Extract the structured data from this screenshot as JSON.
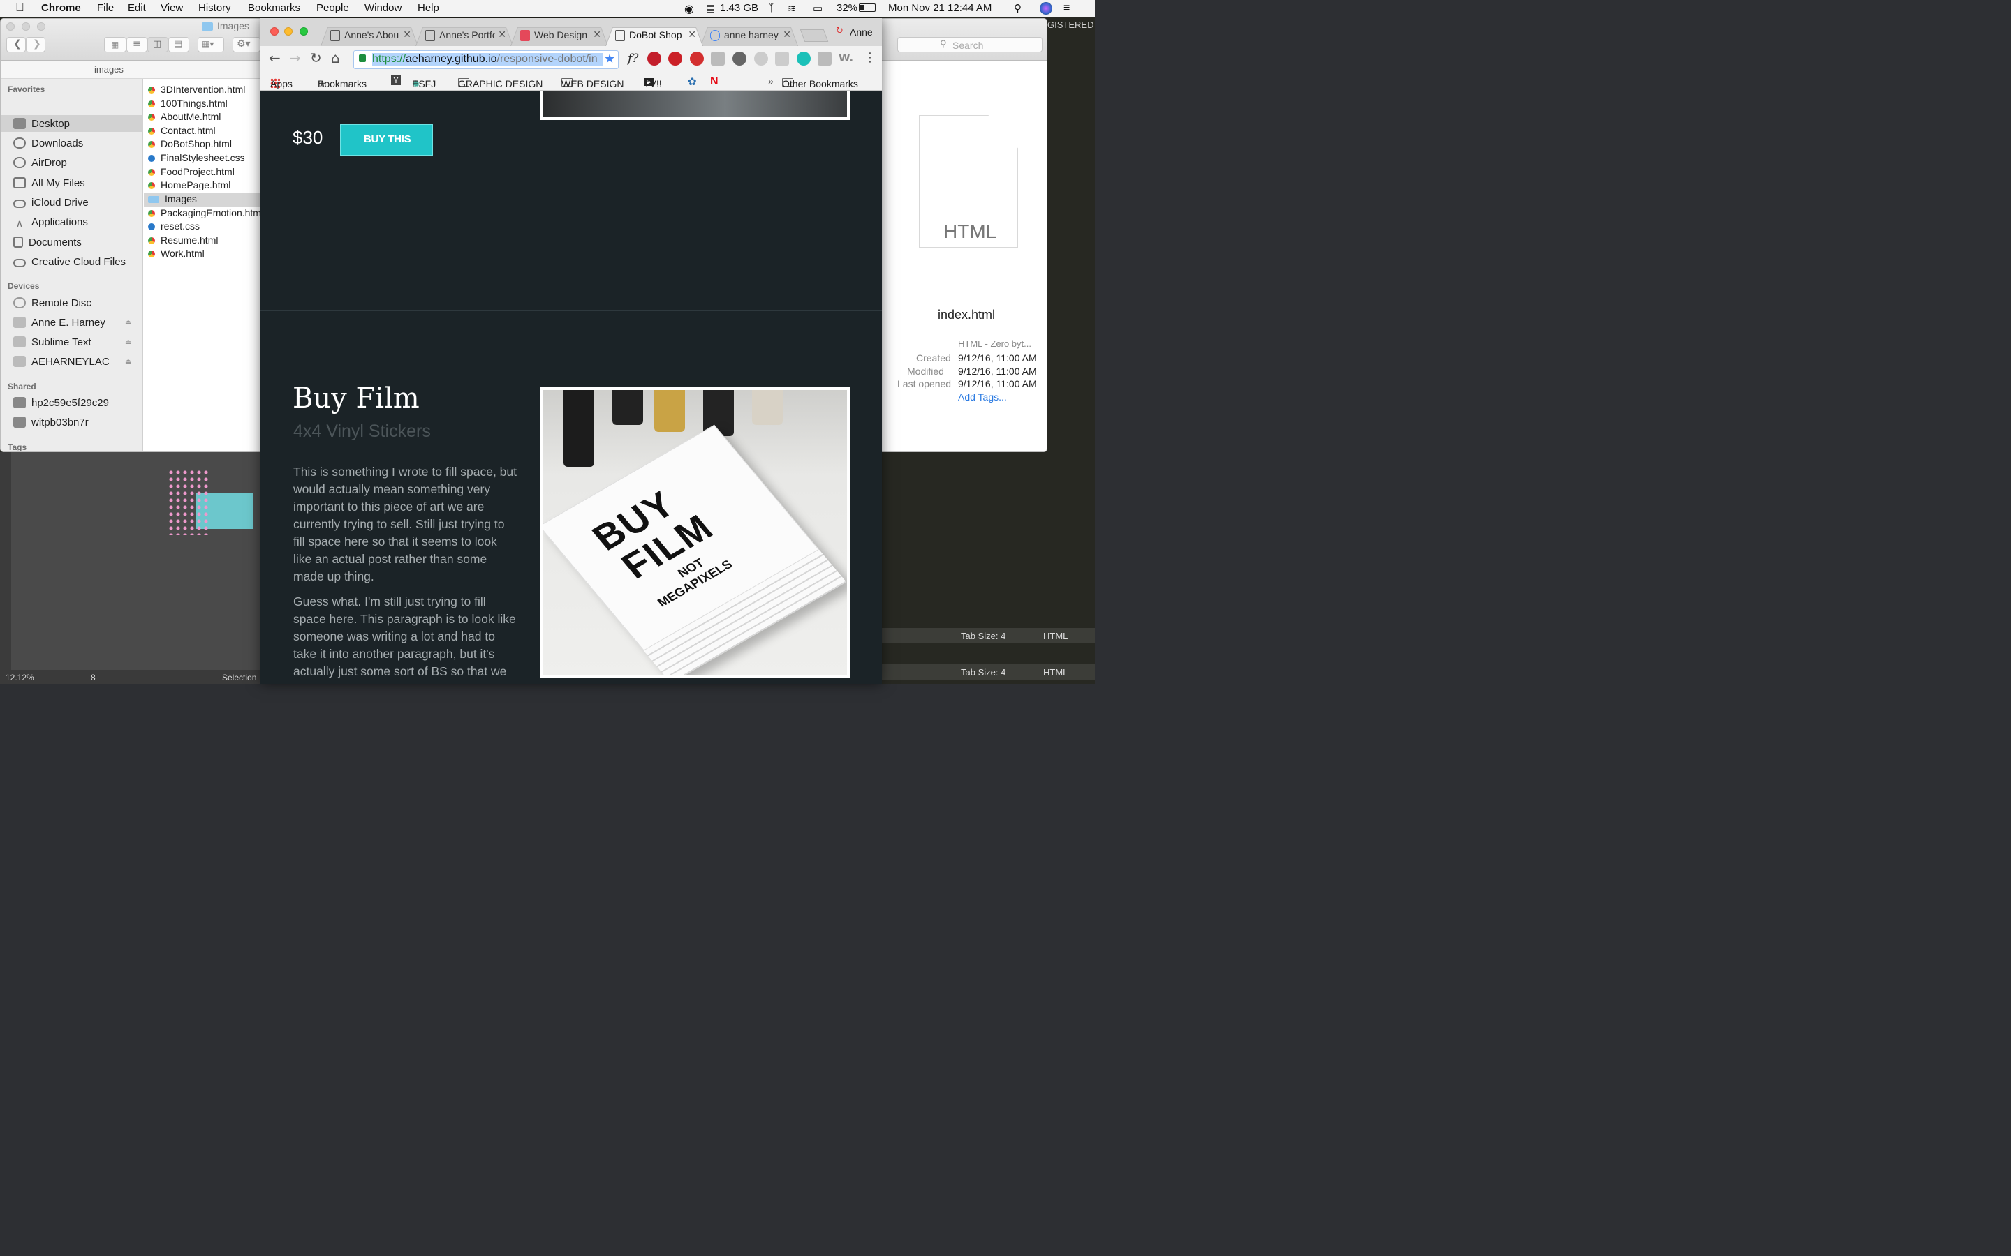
{
  "menubar": {
    "app": "Chrome",
    "items": [
      "File",
      "Edit",
      "View",
      "History",
      "Bookmarks",
      "People",
      "Window",
      "Help"
    ],
    "memory": "1.43 GB",
    "battery": "32%",
    "clock": "Mon Nov 21  12:44 AM"
  },
  "finder": {
    "title": "Images",
    "path_label": "images",
    "sidebar": {
      "favorites_header": "Favorites",
      "favorites": [
        "Desktop",
        "Downloads",
        "AirDrop",
        "All My Files",
        "iCloud Drive",
        "Applications",
        "Documents",
        "Creative Cloud Files"
      ],
      "devices_header": "Devices",
      "devices": [
        "Remote Disc",
        "Anne E. Harney",
        "Sublime Text",
        "AEHARNEYLAC"
      ],
      "shared_header": "Shared",
      "shared": [
        "hp2c59e5f29c29",
        "witpb03bn7r"
      ],
      "tags_header": "Tags"
    },
    "files": [
      "3DIntervention.html",
      "100Things.html",
      "AboutMe.html",
      "Contact.html",
      "DoBotShop.html",
      "FinalStylesheet.css",
      "FoodProject.html",
      "HomePage.html",
      "Images",
      "PackagingEmotion.html",
      "reset.css",
      "Resume.html",
      "Work.html"
    ],
    "search_placeholder": "Search",
    "preview": {
      "icon_label": "HTML",
      "filename": "index.html",
      "kind": "HTML - Zero byt...",
      "created_label": "Created",
      "created": "9/12/16, 11:00 AM",
      "modified_label": "Modified",
      "modified": "9/12/16, 11:00 AM",
      "opened_label": "Last opened",
      "opened": "9/12/16, 11:00 AM",
      "add_tags": "Add Tags..."
    }
  },
  "chrome": {
    "tabs": [
      {
        "label": "Anne's Abou"
      },
      {
        "label": "Anne's Portfo"
      },
      {
        "label": "Web Design"
      },
      {
        "label": "DoBot Shop"
      },
      {
        "label": "anne harney"
      }
    ],
    "profile": "Anne",
    "url_scheme": "https://",
    "url_host": "aeharney.github.io",
    "url_path": "/responsive-dobot/in",
    "bookmarks": [
      "Apps",
      "Bookmarks",
      "ESFJ",
      "GRAPHIC DESIGN",
      "WEB DESIGN",
      "TV!!",
      "Other Bookmarks"
    ],
    "page": {
      "price": "$30",
      "buy_button": "BUY THIS",
      "product_title": "Buy Film",
      "product_subtitle": "4x4 Vinyl Stickers",
      "paragraph1": "This is something I wrote to fill space, but would actually mean something very important to this piece of art we are currently trying to sell. Still just trying to fill space here so that it seems to look like an actual post rather than some made up thing.",
      "paragraph2": "Guess what. I'm still just trying to fill space here. This paragraph is to look like someone was writing a lot and had to take it into another paragraph, but it's actually just some sort of BS so that we",
      "sticker_line1": "BUY",
      "sticker_line2": "FILM",
      "sticker_line3": "NOT",
      "sticker_line4": "MEGAPIXELS"
    }
  },
  "sublime": {
    "registered": "GISTERED",
    "tab_size": "Tab Size: 4",
    "syntax": "HTML"
  },
  "illustrator": {
    "zoom": "12.12%",
    "artboard": "8",
    "tool": "Selection"
  },
  "colors": {
    "page_bg": "#1b2327",
    "buy_button": "#20c4c8",
    "link_blue": "#2a7ae2"
  }
}
